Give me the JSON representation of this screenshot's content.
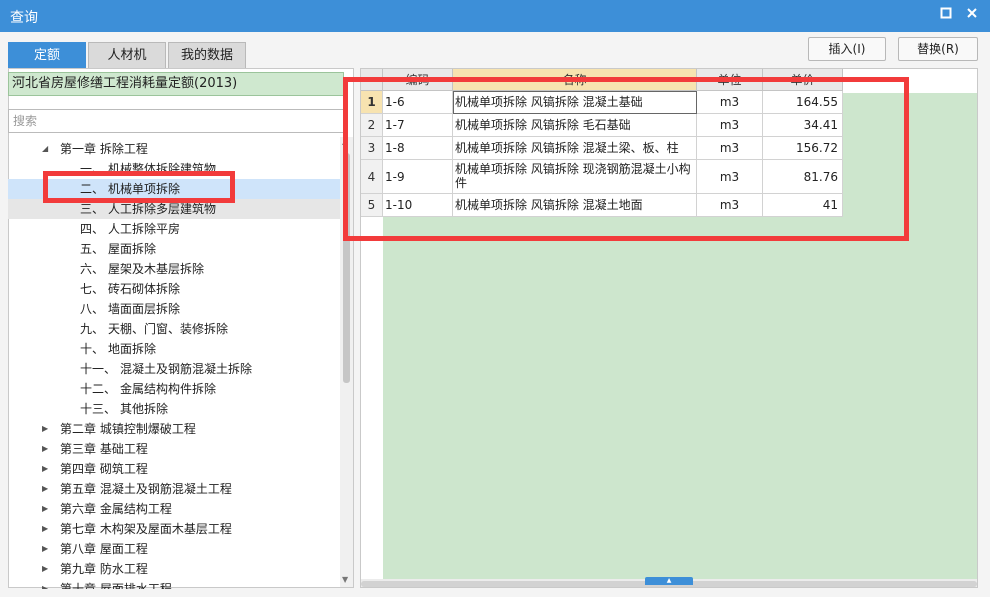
{
  "window": {
    "title": "查询",
    "restore_icon": "restore-icon",
    "close_icon": "close-icon"
  },
  "tabs": [
    {
      "label": "定额",
      "active": true
    },
    {
      "label": "人材机",
      "active": false
    },
    {
      "label": "我的数据",
      "active": false
    }
  ],
  "toolbar": {
    "insert_label": "插入(I)",
    "replace_label": "替换(R)"
  },
  "left": {
    "quota_library": "河北省房屋修缮工程消耗量定额(2013)",
    "search_placeholder": "搜索",
    "tree": [
      {
        "num": "",
        "label": "第一章 拆除工程",
        "level": 0,
        "expanded": true
      },
      {
        "num": "一、",
        "label": "机械整体拆除建筑物",
        "level": 1
      },
      {
        "num": "二、",
        "label": "机械单项拆除",
        "level": 1,
        "selected": true
      },
      {
        "num": "三、",
        "label": "人工拆除多层建筑物",
        "level": 1,
        "hover": true
      },
      {
        "num": "四、",
        "label": "人工拆除平房",
        "level": 1
      },
      {
        "num": "五、",
        "label": "屋面拆除",
        "level": 1
      },
      {
        "num": "六、",
        "label": "屋架及木基层拆除",
        "level": 1
      },
      {
        "num": "七、",
        "label": "砖石砌体拆除",
        "level": 1
      },
      {
        "num": "八、",
        "label": "墙面面层拆除",
        "level": 1
      },
      {
        "num": "九、",
        "label": "天棚、门窗、装修拆除",
        "level": 1
      },
      {
        "num": "十、",
        "label": "地面拆除",
        "level": 1
      },
      {
        "num": "十一、",
        "label": "混凝土及钢筋混凝土拆除",
        "level": 1
      },
      {
        "num": "十二、",
        "label": "金属结构构件拆除",
        "level": 1
      },
      {
        "num": "十三、",
        "label": "其他拆除",
        "level": 1
      },
      {
        "num": "",
        "label": "第二章 城镇控制爆破工程",
        "level": 0
      },
      {
        "num": "",
        "label": "第三章 基础工程",
        "level": 0
      },
      {
        "num": "",
        "label": "第四章 砌筑工程",
        "level": 0
      },
      {
        "num": "",
        "label": "第五章 混凝土及钢筋混凝土工程",
        "level": 0
      },
      {
        "num": "",
        "label": "第六章 金属结构工程",
        "level": 0
      },
      {
        "num": "",
        "label": "第七章 木构架及屋面木基层工程",
        "level": 0
      },
      {
        "num": "",
        "label": "第八章 屋面工程",
        "level": 0
      },
      {
        "num": "",
        "label": "第九章 防水工程",
        "level": 0
      },
      {
        "num": "",
        "label": "第十章 屋面排水工程",
        "level": 0
      }
    ]
  },
  "grid": {
    "columns": [
      "编码",
      "名称",
      "单位",
      "单价"
    ],
    "rows": [
      {
        "no": "1",
        "code": "1-6",
        "name": "机械单项拆除 风镐拆除 混凝土基础",
        "unit": "m3",
        "price": "164.55"
      },
      {
        "no": "2",
        "code": "1-7",
        "name": "机械单项拆除 风镐拆除 毛石基础",
        "unit": "m3",
        "price": "34.41"
      },
      {
        "no": "3",
        "code": "1-8",
        "name": "机械单项拆除 风镐拆除 混凝土梁、板、柱",
        "unit": "m3",
        "price": "156.72"
      },
      {
        "no": "4",
        "code": "1-9",
        "name": "机械单项拆除 风镐拆除 现浇钢筋混凝土小构件",
        "unit": "m3",
        "price": "81.76"
      },
      {
        "no": "5",
        "code": "1-10",
        "name": "机械单项拆除 风镐拆除 混凝土地面",
        "unit": "m3",
        "price": "41"
      }
    ]
  },
  "colors": {
    "accent": "#3d8fd8",
    "grid_background": "#cde6cd",
    "highlight_box": "#f23b3b"
  }
}
